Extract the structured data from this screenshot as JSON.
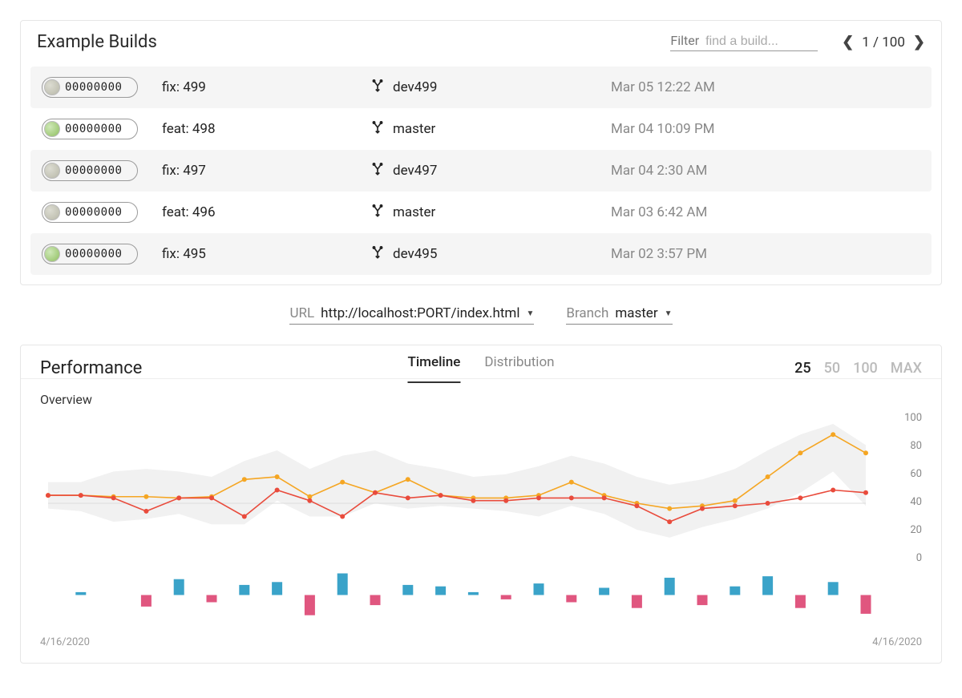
{
  "builds": {
    "title": "Example Builds",
    "filter_label": "Filter",
    "filter_placeholder": "find a build...",
    "pager_text": "1 / 100",
    "rows": [
      {
        "hash": "00000000",
        "msg": "fix: 499",
        "branch": "dev499",
        "time": "Mar 05 12:22 AM",
        "avatar": "a"
      },
      {
        "hash": "00000000",
        "msg": "feat: 498",
        "branch": "master",
        "time": "Mar 04 10:09 PM",
        "avatar": "b"
      },
      {
        "hash": "00000000",
        "msg": "fix: 497",
        "branch": "dev497",
        "time": "Mar 04 2:30 AM",
        "avatar": "a"
      },
      {
        "hash": "00000000",
        "msg": "feat: 496",
        "branch": "master",
        "time": "Mar 03 6:42 AM",
        "avatar": "a"
      },
      {
        "hash": "00000000",
        "msg": "fix: 495",
        "branch": "dev495",
        "time": "Mar 02 3:57 PM",
        "avatar": "b"
      }
    ]
  },
  "selectors": {
    "url_label": "URL",
    "url_value": "http://localhost:PORT/index.html",
    "branch_label": "Branch",
    "branch_value": "master"
  },
  "perf": {
    "title": "Performance",
    "tab_timeline": "Timeline",
    "tab_distribution": "Distribution",
    "counts": [
      "25",
      "50",
      "100",
      "MAX"
    ],
    "overview": "Overview",
    "xstart": "4/16/2020",
    "xend": "4/16/2020"
  },
  "chart_data": {
    "overview_line": {
      "type": "line",
      "title": "Overview",
      "ylim": [
        0,
        100
      ],
      "yticks": [
        0,
        20,
        40,
        60,
        80,
        100
      ],
      "xstart": "4/16/2020",
      "xend": "4/16/2020",
      "series": [
        {
          "name": "band_upper",
          "values": [
            56,
            56,
            64,
            66,
            64,
            60,
            72,
            80,
            66,
            76,
            80,
            70,
            66,
            60,
            62,
            68,
            76,
            70,
            60,
            54,
            58,
            66,
            80,
            92,
            100,
            84
          ]
        },
        {
          "name": "band_lower",
          "values": [
            36,
            34,
            26,
            28,
            32,
            24,
            24,
            42,
            30,
            30,
            40,
            36,
            38,
            36,
            34,
            30,
            38,
            32,
            20,
            14,
            22,
            28,
            36,
            48,
            64,
            38
          ]
        },
        {
          "name": "orange",
          "color": "#f5a623",
          "values": [
            46,
            46,
            45,
            45,
            44,
            45,
            58,
            60,
            45,
            56,
            48,
            58,
            46,
            44,
            44,
            46,
            56,
            46,
            40,
            36,
            38,
            42,
            60,
            78,
            92,
            78
          ]
        },
        {
          "name": "red",
          "color": "#e94b3c",
          "values": [
            46,
            46,
            44,
            34,
            44,
            44,
            30,
            50,
            42,
            30,
            48,
            44,
            46,
            42,
            42,
            44,
            44,
            44,
            38,
            26,
            36,
            38,
            40,
            44,
            50,
            48
          ]
        }
      ]
    },
    "delta_bars": {
      "type": "bar",
      "baseline": 0,
      "series": [
        {
          "name": "blue",
          "color": "#3aa3c9",
          "x": [
            1,
            4,
            6,
            7,
            9,
            11,
            12,
            13,
            15,
            17,
            19,
            21,
            22,
            24
          ],
          "values": [
            4,
            22,
            14,
            18,
            30,
            14,
            12,
            4,
            16,
            10,
            24,
            12,
            26,
            18
          ]
        },
        {
          "name": "pink",
          "color": "#e0567f",
          "x": [
            3,
            5,
            8,
            10,
            14,
            16,
            18,
            20,
            23,
            25
          ],
          "values": [
            -16,
            -10,
            -28,
            -14,
            -6,
            -10,
            -18,
            -14,
            -18,
            -26
          ]
        }
      ],
      "xrange": [
        0,
        25
      ]
    }
  }
}
